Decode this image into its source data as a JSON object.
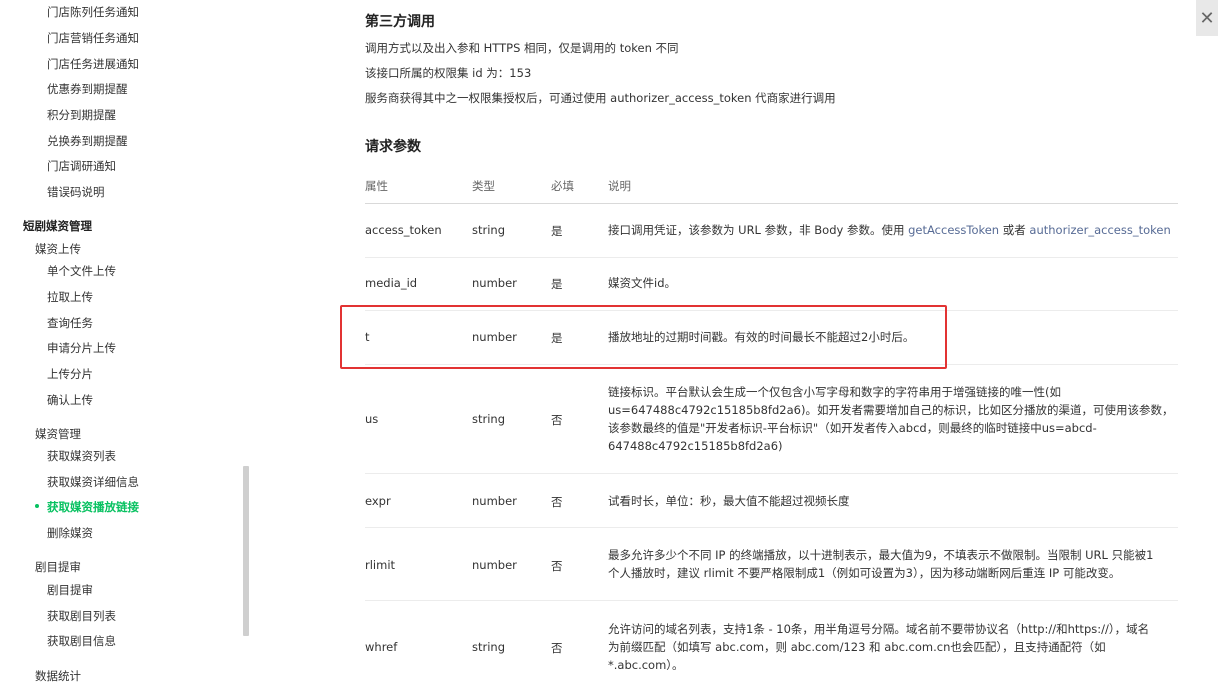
{
  "sidebar": {
    "items_top": [
      "门店陈列任务通知",
      "门店营销任务通知",
      "门店任务进展通知",
      "优惠券到期提醒",
      "积分到期提醒",
      "兑换券到期提醒",
      "门店调研通知",
      "错误码说明"
    ],
    "section": "短剧媒资管理",
    "group_upload": "媒资上传",
    "upload_items": [
      "单个文件上传",
      "拉取上传",
      "查询任务",
      "申请分片上传",
      "上传分片",
      "确认上传"
    ],
    "group_manage": "媒资管理",
    "manage_items": [
      "获取媒资列表",
      "获取媒资详细信息"
    ],
    "active_item": "获取媒资播放链接",
    "manage_after": "删除媒资",
    "group_audit": "剧目提审",
    "audit_items": [
      "剧目提审",
      "获取剧目列表",
      "获取剧目信息"
    ],
    "group_stats": "数据统计"
  },
  "main": {
    "third_party_title": "第三方调用",
    "third_line1": "调用方式以及出入参和 HTTPS 相同，仅是调用的 token 不同",
    "third_line2": "该接口所属的权限集 id 为：153",
    "third_line3": "服务商获得其中之一权限集授权后，可通过使用 authorizer_access_token 代商家进行调用",
    "request_title": "请求参数",
    "headers": [
      "属性",
      "类型",
      "必填",
      "说明"
    ],
    "rows": [
      {
        "name": "access_token",
        "type": "string",
        "required": "是",
        "desc_prefix": "接口调用凭证，该参数为 URL 参数，非 Body 参数。使用 ",
        "link1": "getAccessToken",
        "desc_mid": " 或者 ",
        "link2": "authorizer_access_token"
      },
      {
        "name": "media_id",
        "type": "number",
        "required": "是",
        "desc": "媒资文件id。"
      },
      {
        "name": "t",
        "type": "number",
        "required": "是",
        "desc": "播放地址的过期时间戳。有效的时间最长不能超过2小时后。"
      },
      {
        "name": "us",
        "type": "string",
        "required": "否",
        "desc_lines": [
          "链接标识。平台默认会生成一个仅包含小写字母和数字的字符串用于增强链接的唯一性(如",
          "us=647488c4792c15185b8fd2a6)。如开发者需要增加自己的标识，比如区分播放的渠道，可使用该参数，",
          "该参数最终的值是\"开发者标识-平台标识\"（如开发者传入abcd，则最终的临时链接中us=abcd-",
          "647488c4792c15185b8fd2a6)"
        ]
      },
      {
        "name": "expr",
        "type": "number",
        "required": "否",
        "desc": "试看时长，单位：秒，最大值不能超过视频长度"
      },
      {
        "name": "rlimit",
        "type": "number",
        "required": "否",
        "desc_lines": [
          "最多允许多少个不同 IP 的终端播放，以十进制表示，最大值为9，不填表示不做限制。当限制 URL 只能被1",
          "个人播放时，建议 rlimit 不要严格限制成1（例如可设置为3），因为移动端断网后重连 IP 可能改变。"
        ]
      },
      {
        "name": "whref",
        "type": "string",
        "required": "否",
        "desc_lines": [
          "允许访问的域名列表，支持1条 - 10条，用半角逗号分隔。域名前不要带协议名（http://和https://），域名",
          "为前缀匹配（如填写 abc.com，则 abc.com/123 和 abc.com.cn也会匹配），且支持通配符（如",
          "*.abc.com）。"
        ]
      }
    ]
  },
  "close_label": "✕",
  "colors": {
    "accent": "#07c160",
    "link": "#576b95",
    "highlight": "#e23333"
  }
}
